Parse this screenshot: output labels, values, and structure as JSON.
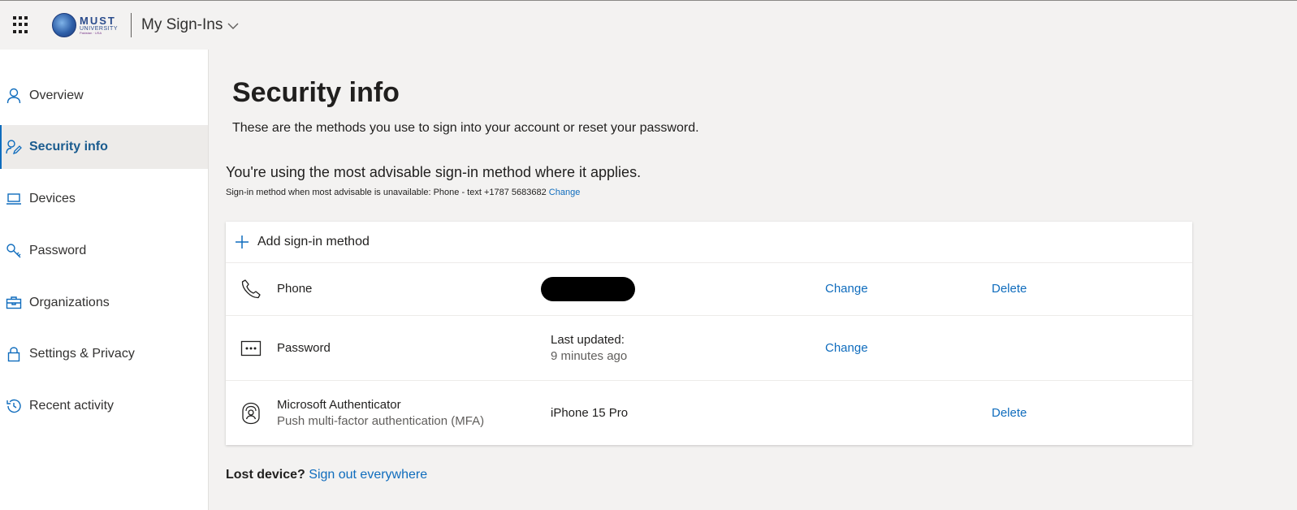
{
  "header": {
    "app_title": "My Sign-Ins",
    "logo": {
      "main": "MUST",
      "sub": "UNIVERSITY",
      "tiny": "Pakistan · USA"
    }
  },
  "sidebar": {
    "items": [
      {
        "label": "Overview",
        "icon": "person-icon"
      },
      {
        "label": "Security info",
        "icon": "person-edit-icon",
        "active": true
      },
      {
        "label": "Devices",
        "icon": "laptop-icon"
      },
      {
        "label": "Password",
        "icon": "key-icon"
      },
      {
        "label": "Organizations",
        "icon": "briefcase-icon"
      },
      {
        "label": "Settings & Privacy",
        "icon": "lock-icon"
      },
      {
        "label": "Recent activity",
        "icon": "history-icon"
      }
    ]
  },
  "main": {
    "title": "Security info",
    "description": "These are the methods you use to sign into your account or reset your password.",
    "advisable": "You're using the most advisable sign-in method where it applies.",
    "fallback_text": "Sign-in method when most advisable is unavailable: Phone - text +1787 5683682",
    "fallback_change": "Change",
    "add_method": "Add sign-in method",
    "methods": [
      {
        "name": "Phone",
        "icon": "phone-icon",
        "detail": "",
        "change": "Change",
        "delete": "Delete"
      },
      {
        "name": "Password",
        "icon": "password-icon",
        "detail_line1": "Last updated:",
        "detail_line2": "9 minutes ago",
        "change": "Change"
      },
      {
        "name": "Microsoft Authenticator",
        "sub": "Push multi-factor authentication (MFA)",
        "icon": "authenticator-icon",
        "detail": "iPhone 15 Pro",
        "delete": "Delete"
      }
    ],
    "lost_device": "Lost device?",
    "sign_out": "Sign out everywhere"
  },
  "colors": {
    "accent": "#0f6cbd",
    "active_bg": "#edebe9",
    "page_bg": "#f3f2f1"
  }
}
